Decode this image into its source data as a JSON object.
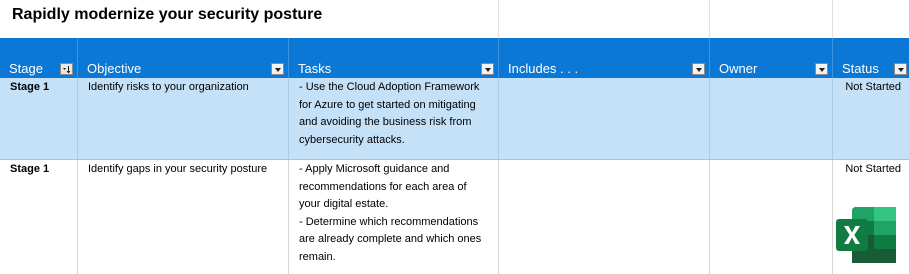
{
  "title": "Rapidly modernize your security posture",
  "columns": [
    {
      "label": "Stage"
    },
    {
      "label": "Objective"
    },
    {
      "label": "Tasks"
    },
    {
      "label": "Includes . . ."
    },
    {
      "label": "Owner"
    },
    {
      "label": "Status"
    }
  ],
  "rows": [
    {
      "stage": "Stage 1",
      "objective": "Identify risks to your organization",
      "tasks": [
        "- Use the Cloud Adoption Framework",
        "for Azure to get started on mitigating",
        "and avoiding the business risk from",
        "cybersecurity attacks."
      ],
      "includes": "",
      "owner": "",
      "status": "Not Started"
    },
    {
      "stage": "Stage 1",
      "objective": "Identify gaps in your security posture",
      "tasks": [
        "- Apply Microsoft guidance and",
        "recommendations for each area of",
        "your digital estate.",
        "- Determine which recommendations",
        "are already complete and which ones",
        "remain."
      ],
      "includes": "",
      "owner": "",
      "status": "Not Started"
    }
  ],
  "icons": {
    "filter": "filter-dropdown-icon",
    "excel": "excel-icon"
  },
  "colors": {
    "header_bg": "#0a78d4",
    "row_highlight": "#c5e1f8",
    "excel_green": "#107c41"
  }
}
